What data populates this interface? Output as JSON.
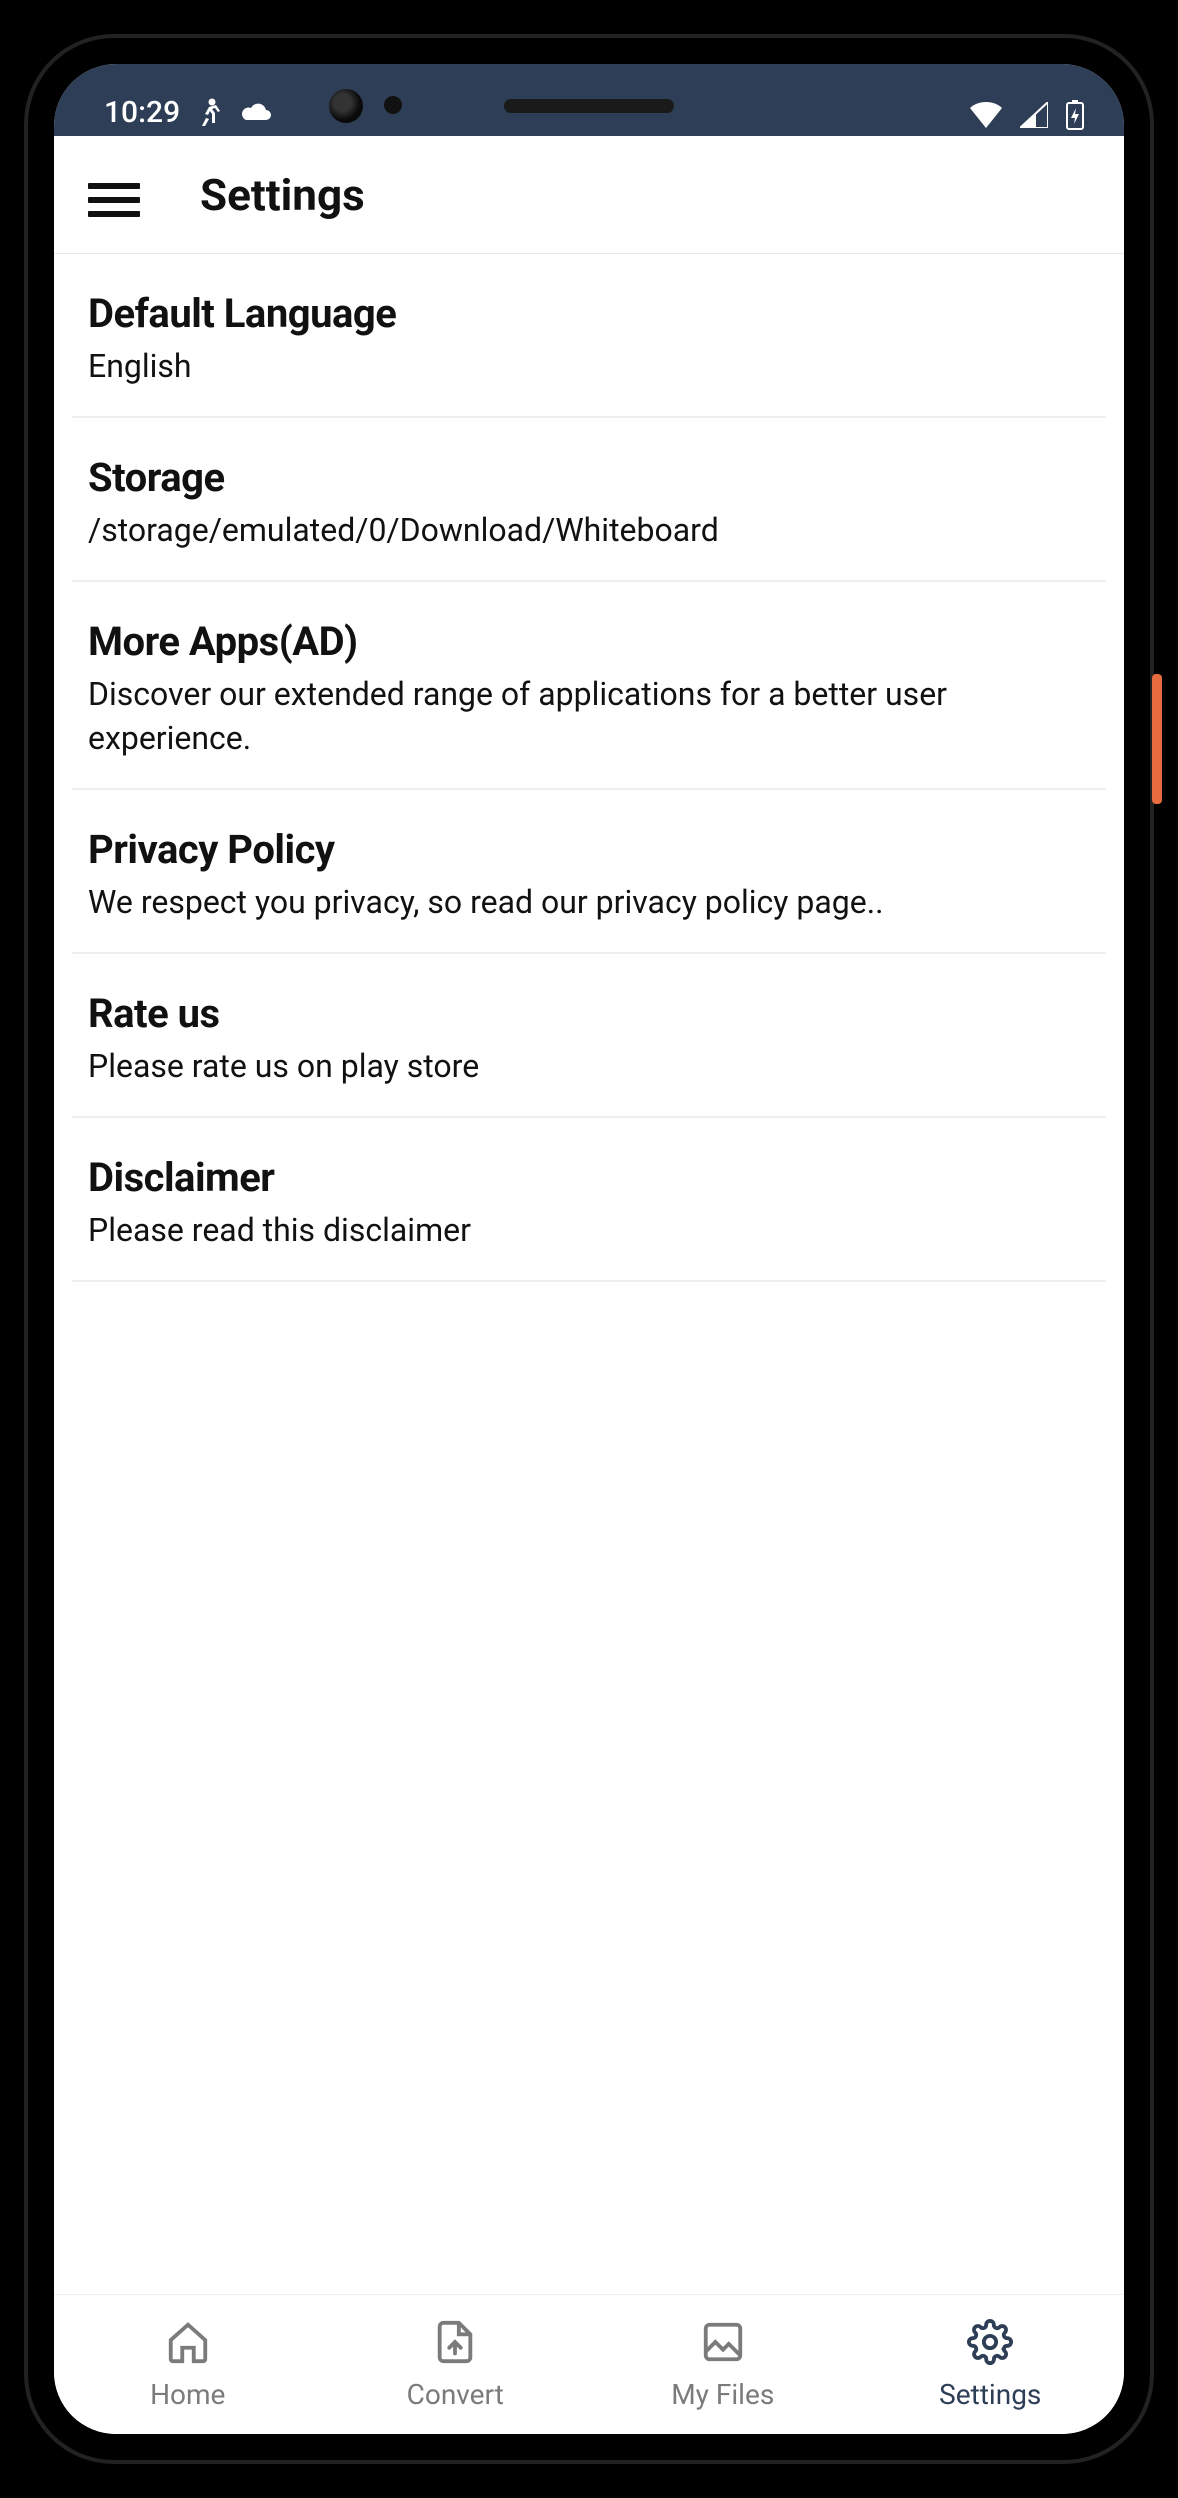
{
  "statusbar": {
    "time": "10:29"
  },
  "header": {
    "title": "Settings"
  },
  "settings": [
    {
      "title": "Default Language",
      "subtitle": "English"
    },
    {
      "title": "Storage",
      "subtitle": "/storage/emulated/0/Download/Whiteboard"
    },
    {
      "title": "More Apps(AD)",
      "subtitle": "Discover our extended range of applications for a better user experience."
    },
    {
      "title": "Privacy Policy",
      "subtitle": "We respect you privacy, so read our privacy policy page.."
    },
    {
      "title": "Rate us",
      "subtitle": "Please rate us on play store"
    },
    {
      "title": "Disclaimer",
      "subtitle": "Please read this disclaimer"
    }
  ],
  "bottomnav": {
    "items": [
      {
        "label": "Home"
      },
      {
        "label": "Convert"
      },
      {
        "label": "My Files"
      },
      {
        "label": "Settings"
      }
    ],
    "activeIndex": 3
  }
}
